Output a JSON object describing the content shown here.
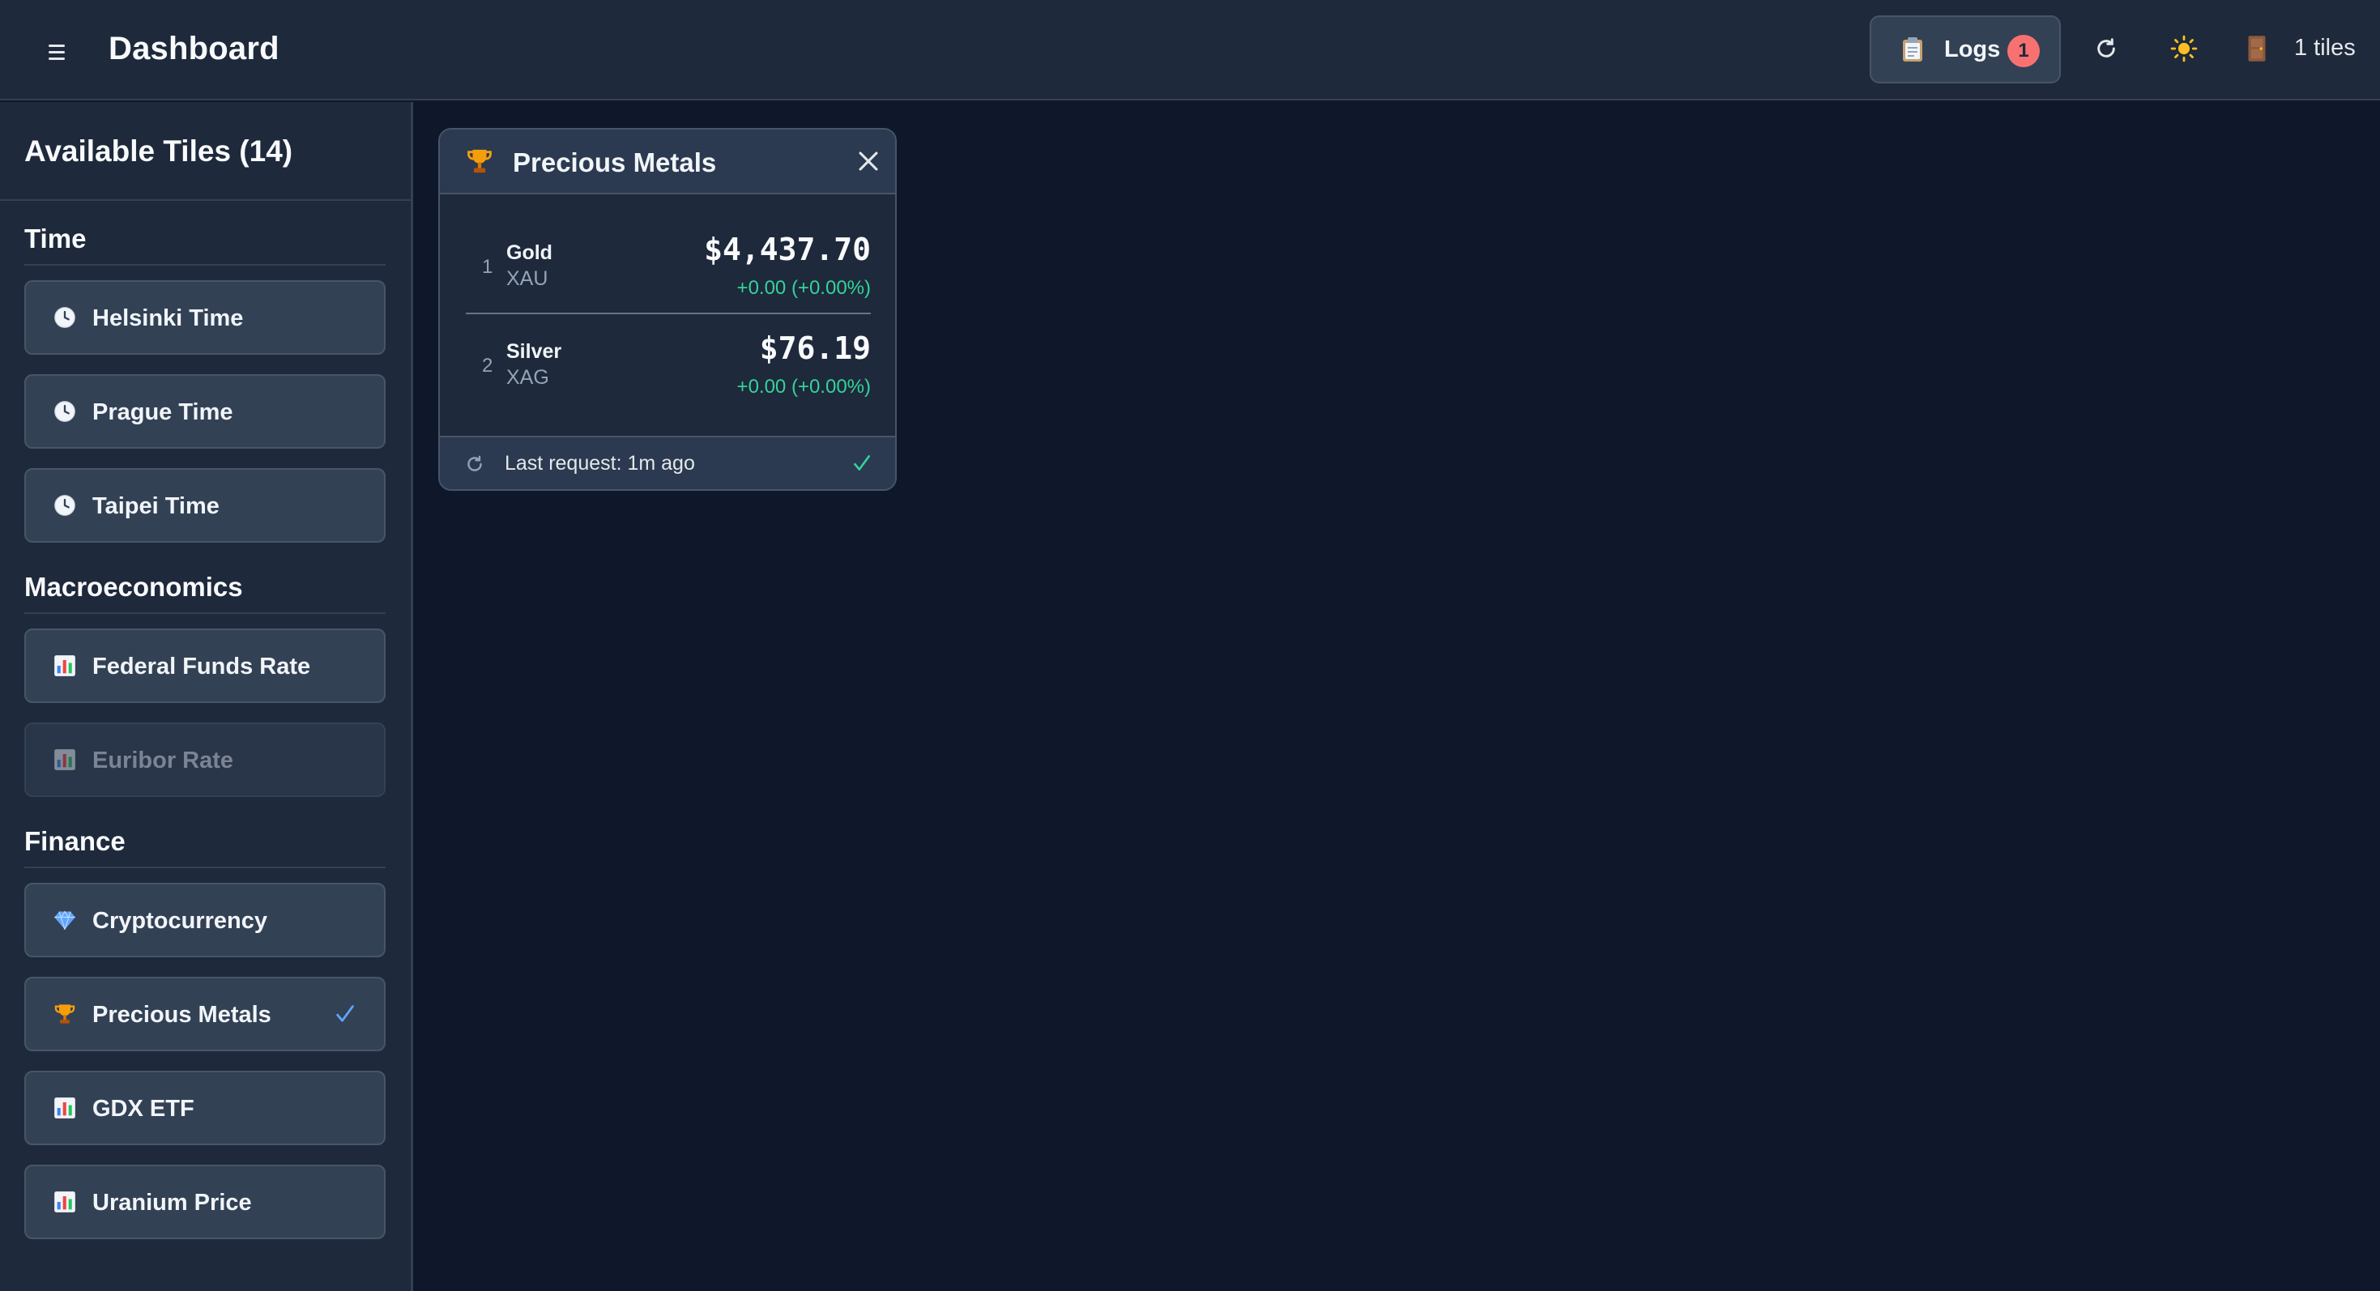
{
  "header": {
    "title": "Dashboard",
    "logs_label": "Logs",
    "logs_badge": "1",
    "tiles_count": "1 tiles",
    "icons": [
      "menu-icon",
      "clipboard-icon",
      "refresh-icon",
      "sun-icon",
      "door-icon"
    ]
  },
  "sidebar": {
    "title": "Available Tiles (14)",
    "sections": [
      {
        "title": "Time",
        "items": [
          {
            "label": "Helsinki Time",
            "icon": "clock-icon"
          },
          {
            "label": "Prague Time",
            "icon": "clock-icon"
          },
          {
            "label": "Taipei Time",
            "icon": "clock-icon"
          }
        ]
      },
      {
        "title": "Macroeconomics",
        "items": [
          {
            "label": "Federal Funds Rate",
            "icon": "bar-chart-icon"
          },
          {
            "label": "Euribor Rate",
            "icon": "bar-chart-icon",
            "disabled": true
          }
        ]
      },
      {
        "title": "Finance",
        "items": [
          {
            "label": "Cryptocurrency",
            "icon": "gem-icon"
          },
          {
            "label": "Precious Metals",
            "icon": "trophy-icon",
            "active": true
          },
          {
            "label": "GDX ETF",
            "icon": "bar-chart-icon"
          },
          {
            "label": "Uranium Price",
            "icon": "bar-chart-icon"
          }
        ]
      }
    ]
  },
  "card": {
    "title": "Precious Metals",
    "icon": "trophy-icon",
    "rows": [
      {
        "rank": "1",
        "name": "Gold",
        "symbol": "XAU",
        "price": "$4,437.70",
        "change": "+0.00 (+0.00%)"
      },
      {
        "rank": "2",
        "name": "Silver",
        "symbol": "XAG",
        "price": "$76.19",
        "change": "+0.00 (+0.00%)"
      }
    ],
    "footer": {
      "text": "Last request: 1m ago",
      "status": "ok"
    }
  },
  "colors": {
    "background": "#0f172a",
    "panel": "#1e293b",
    "item": "#334155",
    "positive": "#34d399",
    "badge": "#f87171",
    "check": "#60a5fa"
  }
}
